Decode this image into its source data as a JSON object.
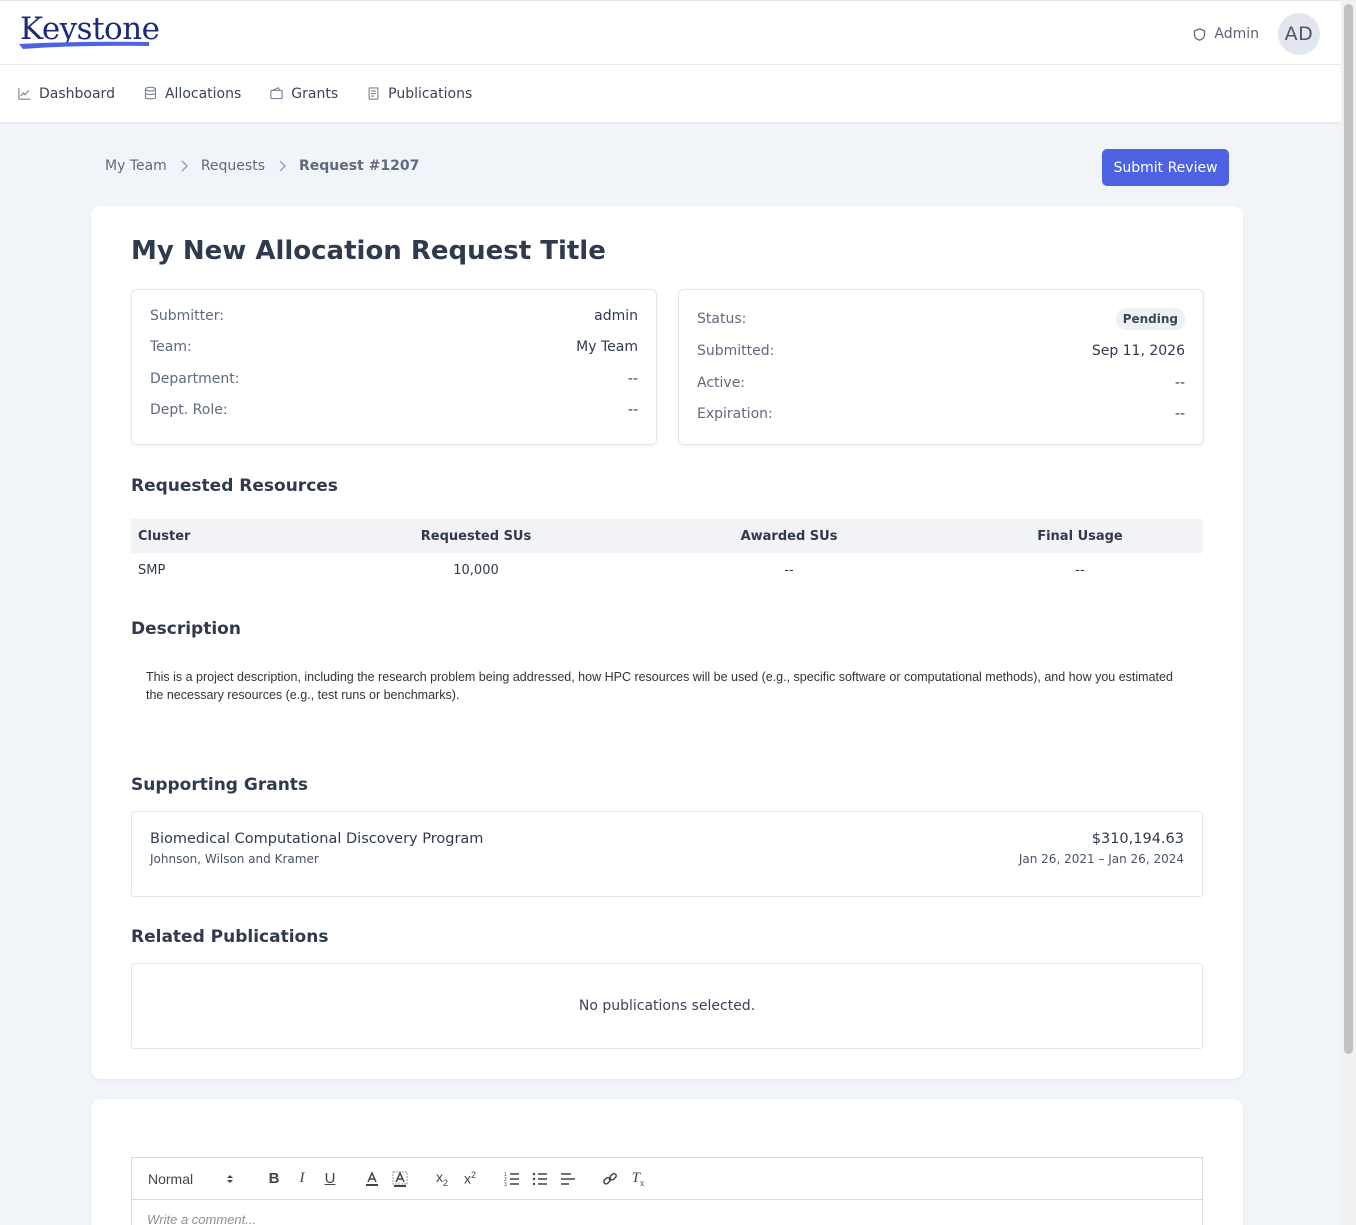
{
  "app": {
    "logo_text": "Keystone",
    "admin_label": "Admin",
    "avatar_initials": "AD"
  },
  "nav": {
    "items": [
      {
        "label": "Dashboard",
        "icon": "chart-line-icon"
      },
      {
        "label": "Allocations",
        "icon": "database-icon"
      },
      {
        "label": "Grants",
        "icon": "wallet-icon"
      },
      {
        "label": "Publications",
        "icon": "document-icon"
      }
    ]
  },
  "breadcrumb": {
    "items": [
      "My Team",
      "Requests"
    ],
    "current": "Request #1207"
  },
  "actions": {
    "submit_review": "Submit Review"
  },
  "request": {
    "title": "My New Allocation Request Title",
    "left_info": [
      {
        "label": "Submitter:",
        "value": "admin"
      },
      {
        "label": "Team:",
        "value": "My Team"
      },
      {
        "label": "Department:",
        "value": "--"
      },
      {
        "label": "Dept. Role:",
        "value": "--"
      }
    ],
    "right_info": [
      {
        "label": "Status:",
        "value": "Pending"
      },
      {
        "label": "Submitted:",
        "value": "Sep 11, 2026"
      },
      {
        "label": "Active:",
        "value": "--"
      },
      {
        "label": "Expiration:",
        "value": "--"
      }
    ]
  },
  "resources": {
    "heading": "Requested Resources",
    "columns": [
      "Cluster",
      "Requested SUs",
      "Awarded SUs",
      "Final Usage"
    ],
    "rows": [
      [
        "SMP",
        "10,000",
        "--",
        "--"
      ]
    ]
  },
  "description": {
    "heading": "Description",
    "text": "This is a project description, including the research problem being addressed, how HPC resources will be used (e.g., specific software or computational methods), and how you estimated the necessary resources (e.g., test runs or benchmarks)."
  },
  "grants": {
    "heading": "Supporting Grants",
    "items": [
      {
        "title": "Biomedical Computational Discovery Program",
        "agency": "Johnson, Wilson and Kramer",
        "amount": "$310,194.63",
        "dates": "Jan 26, 2021 – Jan 26, 2024"
      }
    ]
  },
  "publications": {
    "heading": "Related Publications",
    "empty_text": "No publications selected."
  },
  "comment_editor": {
    "format_value": "Normal",
    "placeholder": "Write a comment..."
  },
  "colors": {
    "accent": "#4e63e3",
    "logo": "#1d2a7a",
    "background": "#f1f4f9"
  }
}
